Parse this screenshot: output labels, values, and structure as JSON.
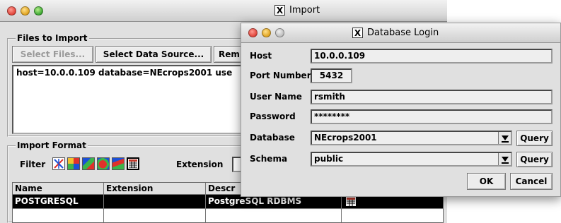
{
  "import_window": {
    "title": "Import",
    "files_group": {
      "label": "Files to Import",
      "buttons": {
        "select_files": "Select Files...",
        "select_data_source": "Select Data Source...",
        "remove": "Rem"
      },
      "file_line": "host=10.0.0.109  database=NEcrops2001  use"
    },
    "format_group": {
      "label": "Import Format",
      "filter_label": "Filter",
      "extension_label": "Extension",
      "filter_icons": [
        "vector-filter-icon",
        "raster-grid-icon",
        "map-layer-icon",
        "polygon-icon",
        "region-icon",
        "table-icon"
      ],
      "columns": [
        "Name",
        "Extension",
        "Descr"
      ],
      "rows": [
        {
          "name": "POSTGRESQL",
          "extension": "",
          "description": "PostgreSQL RDBMS",
          "icon": "table-icon"
        }
      ]
    }
  },
  "login_dialog": {
    "title": "Database Login",
    "fields": {
      "host": {
        "label": "Host",
        "value": "10.0.0.109"
      },
      "port": {
        "label": "Port Number",
        "value": "5432"
      },
      "user": {
        "label": "User Name",
        "value": "rsmith"
      },
      "password": {
        "label": "Password",
        "value": "********"
      },
      "database": {
        "label": "Database",
        "value": "NEcrops2001"
      },
      "schema": {
        "label": "Schema",
        "value": "public"
      }
    },
    "buttons": {
      "query_database": "Query",
      "query_schema": "Query",
      "ok": "OK",
      "cancel": "Cancel"
    }
  }
}
